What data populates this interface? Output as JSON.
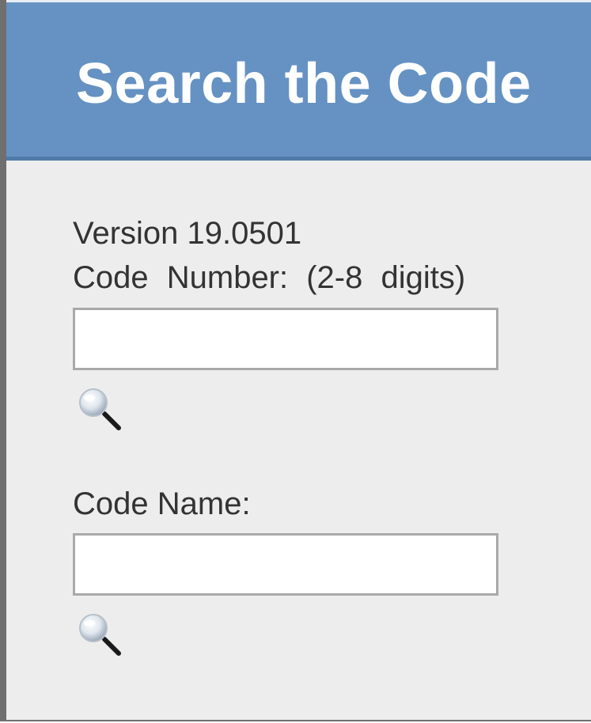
{
  "header": {
    "title": "Search the Code"
  },
  "form": {
    "version_text": "Version 19.0501",
    "code_number": {
      "label": "Code Number: (2-8 digits)",
      "value": "",
      "placeholder": ""
    },
    "code_name": {
      "label": "Code Name:",
      "value": "",
      "placeholder": ""
    },
    "search_icon": "magnifier-icon"
  },
  "colors": {
    "header_bg": "#6592c3",
    "panel_bg": "#ededed",
    "text": "#333333",
    "header_text": "#ffffff"
  }
}
